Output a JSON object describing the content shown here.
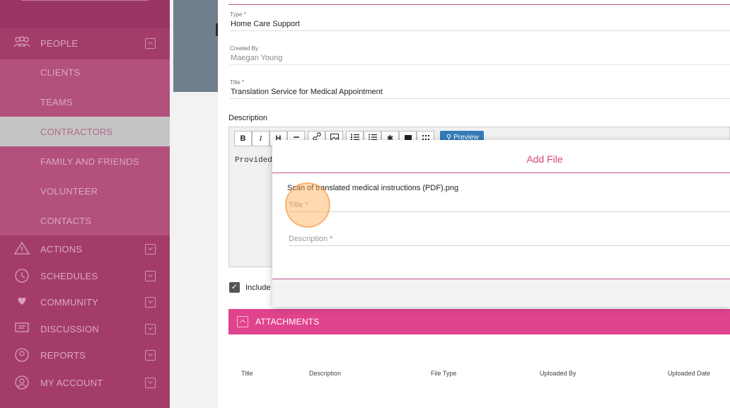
{
  "sidebar": {
    "items": [
      {
        "label": "PEOPLE",
        "icon": "people-icon",
        "chevron": "up"
      },
      {
        "label": "CLIENTS"
      },
      {
        "label": "TEAMS"
      },
      {
        "label": "CONTRACTORS",
        "active": true
      },
      {
        "label": "FAMILY AND FRIENDS"
      },
      {
        "label": "VOLUNTEER"
      },
      {
        "label": "CONTACTS"
      },
      {
        "label": "ACTIONS",
        "icon": "warning-icon",
        "chevron": "down"
      },
      {
        "label": "SCHEDULES",
        "icon": "clock-icon",
        "chevron": "down"
      },
      {
        "label": "COMMUNITY",
        "icon": "heart-hands-icon",
        "chevron": "down"
      },
      {
        "label": "DISCUSSION",
        "icon": "chat-icon",
        "chevron": "down"
      },
      {
        "label": "REPORTS",
        "icon": "reports-icon",
        "chevron": "down"
      },
      {
        "label": "MY ACCOUNT",
        "icon": "user-icon",
        "chevron": "down"
      }
    ]
  },
  "form": {
    "type_label": "Type *",
    "type_value": "Home Care Support",
    "created_by_label": "Created By",
    "created_by_value": "Maegan Young",
    "title_label": "Title *",
    "title_value": "Translation Service for Medical Appointment",
    "description_heading": "Description",
    "toolbar": {
      "bold": "B",
      "italic": "I",
      "heading": "H",
      "preview_label": "Preview"
    },
    "editor_text": "Provided",
    "include_label": "Include",
    "include_checked": true
  },
  "attachments": {
    "title": "ATTACHMENTS",
    "columns": [
      "Title",
      "Description",
      "File Type",
      "Uploaded By",
      "Uploaded Date"
    ]
  },
  "add_file": {
    "title": "Add File",
    "file_name": "Scan of translated medical instructions (PDF).png",
    "title_placeholder": "Title *",
    "description_placeholder": "Description *"
  },
  "colors": {
    "sidebar": "#a43c6a",
    "accent": "#e0438d",
    "dialog_title": "#d6467f",
    "preview_button": "#337ab7"
  }
}
